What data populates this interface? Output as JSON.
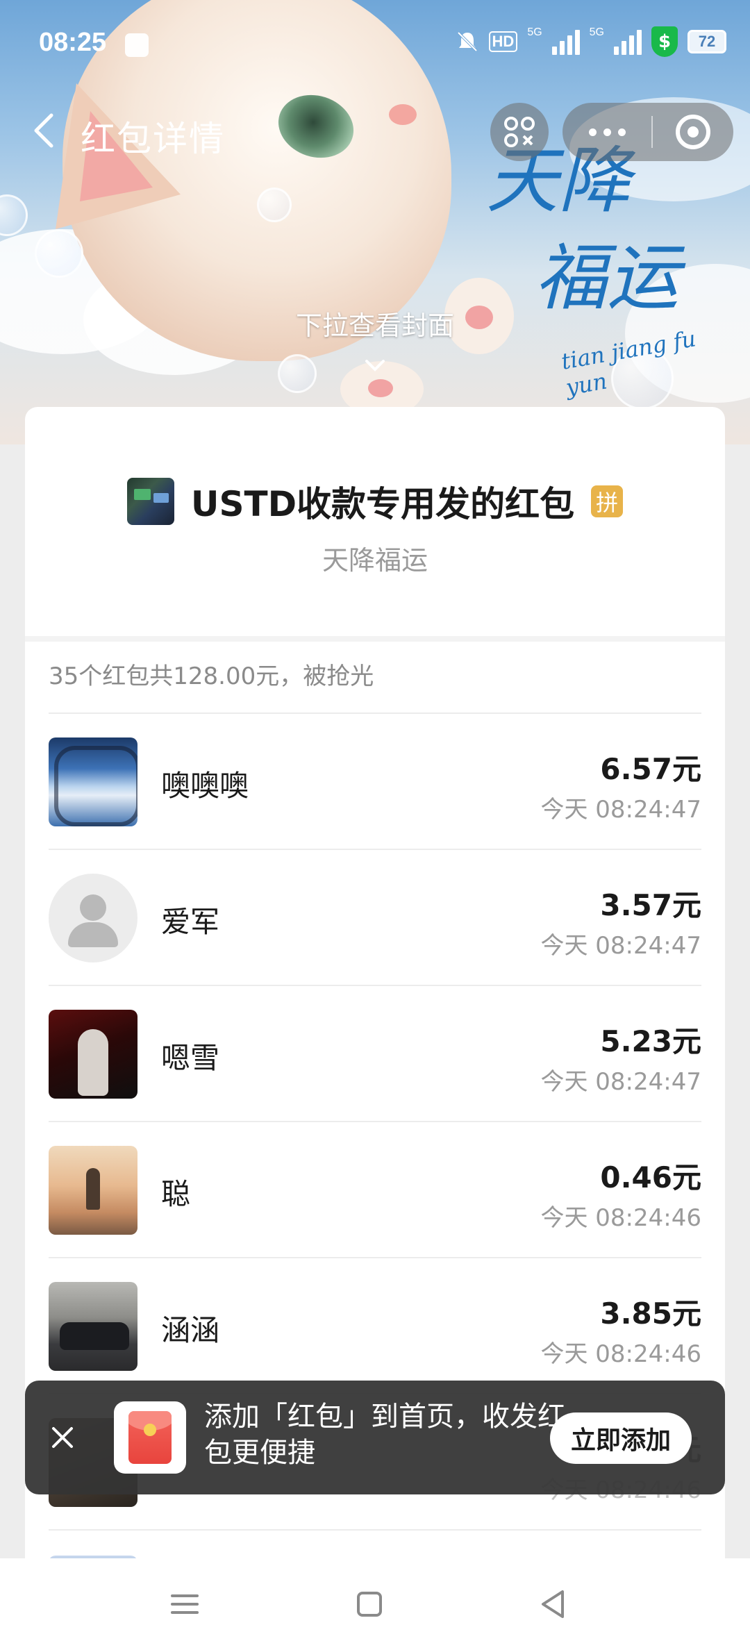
{
  "status_bar": {
    "time": "08:25",
    "hd_label": "HD",
    "net1": "5G",
    "net2": "5G",
    "battery": "72",
    "icons": [
      "mute-icon",
      "signal-icon",
      "shield-dollar-icon",
      "battery-icon"
    ]
  },
  "header": {
    "title": "红包详情",
    "pull_hint": "下拉查看封面",
    "cover_text_line1": "天降",
    "cover_text_line2": "福运",
    "cover_pinyin": "tian jiang fu yun"
  },
  "packet": {
    "sender": "USTD收款专用发的红包",
    "badge": "拼",
    "wish": "天降福运",
    "summary": "35个红包共128.00元，被抢光"
  },
  "recipients": [
    {
      "name": "噢噢噢",
      "amount": "6.57元",
      "time": "今天 08:24:47",
      "avatar": "sky-window"
    },
    {
      "name": "爱军",
      "amount": "3.57元",
      "time": "今天 08:24:47",
      "avatar": "default"
    },
    {
      "name": "嗯雪",
      "amount": "5.23元",
      "time": "今天 08:24:47",
      "avatar": "dark-figure"
    },
    {
      "name": "聪",
      "amount": "0.46元",
      "time": "今天 08:24:46",
      "avatar": "mountain-figure"
    },
    {
      "name": "涵涵",
      "amount": "3.85元",
      "time": "今天 08:24:46",
      "avatar": "car"
    }
  ],
  "partial_row": {
    "amount_tail": "元",
    "time": "今天 08:24:46"
  },
  "toast": {
    "text": "添加「红包」到首页，收发红包更便捷",
    "button": "立即添加"
  },
  "colors": {
    "accent_blue": "#1f73bd",
    "badge_gold": "#e8b34a",
    "toast_bg": "#343434"
  }
}
